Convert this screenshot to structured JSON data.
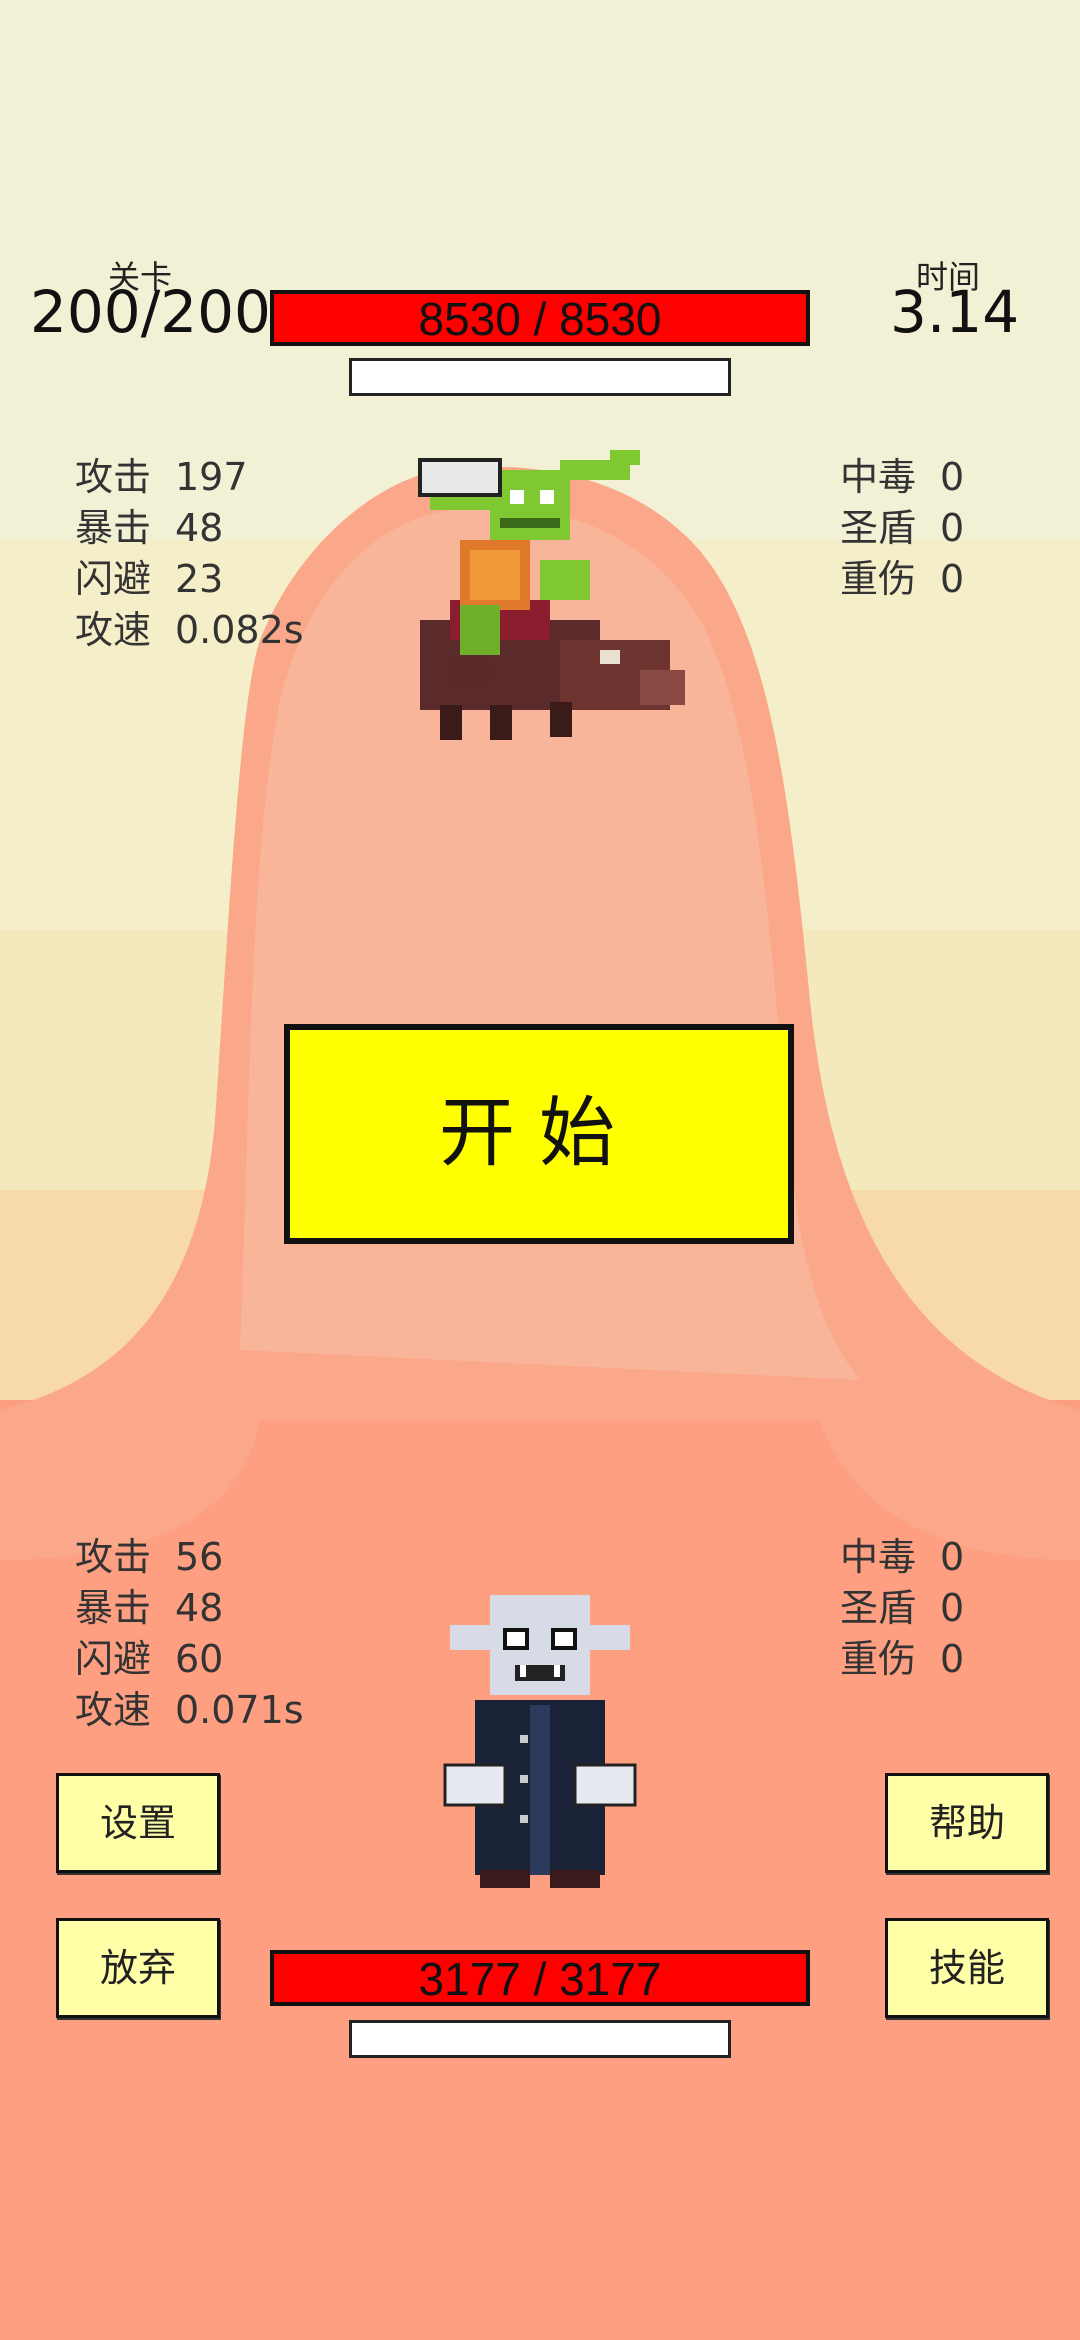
{
  "hud": {
    "level_label": "关卡",
    "level_value": "200/200",
    "time_label": "时间",
    "time_value": "3.14"
  },
  "enemy": {
    "hp_text": "8530 / 8530",
    "hp_fraction": 1.0,
    "stats_left": [
      {
        "k": "攻击",
        "v": "197"
      },
      {
        "k": "暴击",
        "v": "48"
      },
      {
        "k": "闪避",
        "v": "23"
      },
      {
        "k": "攻速",
        "v": "0.082s"
      }
    ],
    "stats_right": [
      {
        "k": "中毒",
        "v": "0"
      },
      {
        "k": "圣盾",
        "v": "0"
      },
      {
        "k": "重伤",
        "v": "0"
      }
    ],
    "sprite": "goblin-boar-rider"
  },
  "player": {
    "hp_text": "3177 / 3177",
    "hp_fraction": 1.0,
    "stats_left": [
      {
        "k": "攻击",
        "v": "56"
      },
      {
        "k": "暴击",
        "v": "48"
      },
      {
        "k": "闪避",
        "v": "60"
      },
      {
        "k": "攻速",
        "v": "0.071s"
      }
    ],
    "stats_right": [
      {
        "k": "中毒",
        "v": "0"
      },
      {
        "k": "圣盾",
        "v": "0"
      },
      {
        "k": "重伤",
        "v": "0"
      }
    ],
    "sprite": "vampire"
  },
  "buttons": {
    "start": "开始",
    "settings": "设置",
    "help": "帮助",
    "give_up": "放弃",
    "skills": "技能"
  },
  "colors": {
    "hp_bar": "#ff0000",
    "start_button": "#ffff00",
    "side_button": "#ffffa8"
  }
}
